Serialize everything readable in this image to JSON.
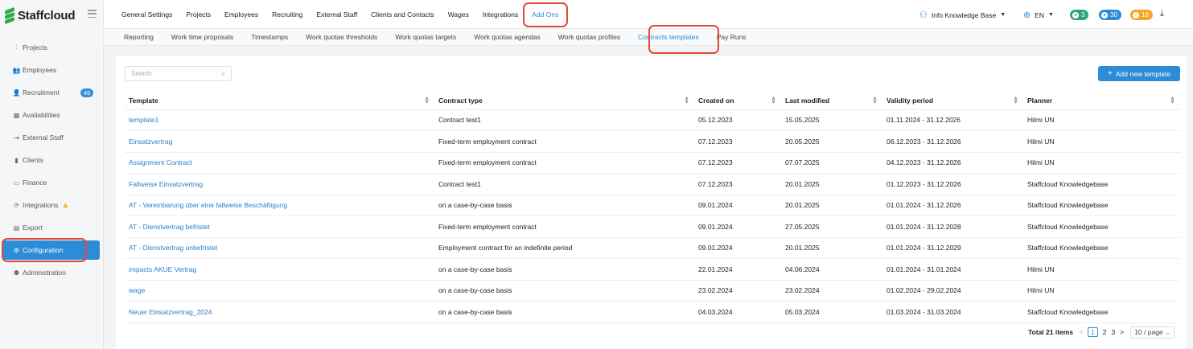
{
  "app": {
    "name": "Staffcloud"
  },
  "sidebar": {
    "items": [
      {
        "label": "Projects",
        "icon": "projects-icon",
        "glyph": "⫶"
      },
      {
        "label": "Employees",
        "icon": "employees-icon",
        "glyph": "👥"
      },
      {
        "label": "Recruitment",
        "icon": "recruitment-icon",
        "glyph": "👤",
        "badge": "45"
      },
      {
        "label": "Availabilities",
        "icon": "calendar-icon",
        "glyph": "▦"
      },
      {
        "label": "External Staff",
        "icon": "external-staff-icon",
        "glyph": "⇥"
      },
      {
        "label": "Clients",
        "icon": "clients-icon",
        "glyph": "▮"
      },
      {
        "label": "Finance",
        "icon": "finance-icon",
        "glyph": "▭"
      },
      {
        "label": "Integrations",
        "icon": "integrations-icon",
        "glyph": "⟳"
      },
      {
        "label": "Export",
        "icon": "export-icon",
        "glyph": "▤"
      },
      {
        "label": "Configuration",
        "icon": "gear-icon",
        "glyph": "⚙"
      },
      {
        "label": "Administration",
        "icon": "administration-icon",
        "glyph": "⚉"
      }
    ]
  },
  "topmenu": [
    "General Settings",
    "Projects",
    "Employees",
    "Recruiting",
    "External Staff",
    "Clients and Contacts",
    "Wages",
    "Integrations",
    "Add Ons"
  ],
  "user": {
    "name": "Info Knowledge Base",
    "lang": "EN"
  },
  "pills": [
    {
      "value": "3",
      "color": "#2aa57a"
    },
    {
      "value": "30",
      "color": "#2d8cd8"
    },
    {
      "value": "18",
      "color": "#f5a623"
    }
  ],
  "subtabs": [
    "Reporting",
    "Work time proposals",
    "Timestamps",
    "Work quotas thresholds",
    "Work quotas targets",
    "Work quotas agendas",
    "Work quotas profiles",
    "Contracts templates",
    "Pay Runs"
  ],
  "toolbar": {
    "search_placeholder": "Search",
    "add_label": "Add new template"
  },
  "table": {
    "headers": [
      "Template",
      "Contract type",
      "Created on",
      "Last modified",
      "Validity period",
      "Planner"
    ],
    "rows": [
      [
        "template1",
        "Contract test1",
        "05.12.2023",
        "15.05.2025",
        "01.11.2024 - 31.12.2026",
        "Hilmi UN"
      ],
      [
        "Einsatzvertrag",
        "Fixed-term employment contract",
        "07.12.2023",
        "20.05.2025",
        "06.12.2023 - 31.12.2026",
        "Hilmi UN"
      ],
      [
        "Assignment Contract",
        "Fixed-term employment contract",
        "07.12.2023",
        "07.07.2025",
        "04.12.2023 - 31.12.2026",
        "Hilmi UN"
      ],
      [
        "Fallweise Einsatzvertrag",
        "Contract test1",
        "07.12.2023",
        "20.01.2025",
        "01.12.2023 - 31.12.2026",
        "Staffcloud Knowledgebase"
      ],
      [
        "AT - Vereinbarung über eine fallweise Beschäftigung",
        "on a case-by-case basis",
        "09.01.2024",
        "20.01.2025",
        "01.01.2024 - 31.12.2026",
        "Staffcloud Knowledgebase"
      ],
      [
        "AT - Dienstvertrag befristet",
        "Fixed-term employment contract",
        "09.01.2024",
        "27.05.2025",
        "01.01.2024 - 31.12.2028",
        "Staffcloud Knowledgebase"
      ],
      [
        "AT - Dienstvertrag unbefristet",
        "Employment contract for an indefinite period",
        "09.01.2024",
        "20.01.2025",
        "01.01.2024 - 31.12.2029",
        "Staffcloud Knowledgebase"
      ],
      [
        "impacts AKUE Vertrag",
        "on a case-by-case basis",
        "22.01.2024",
        "04.06.2024",
        "01.01.2024 - 31.01.2024",
        "Hilmi UN"
      ],
      [
        "wage",
        "on a case-by-case basis",
        "23.02.2024",
        "23.02.2024",
        "01.02.2024 - 29.02.2024",
        "Hilmi UN"
      ],
      [
        "Neuer Einsatzvertrag_2024",
        "on a case-by-case basis",
        "04.03.2024",
        "05.03.2024",
        "01.03.2024 - 31.03.2024",
        "Staffcloud Knowledgebase"
      ]
    ]
  },
  "pagination": {
    "total": "Total 21 items",
    "prev": "<",
    "pages": [
      "1",
      "2",
      "3"
    ],
    "next": ">",
    "page_size": "10 / page"
  }
}
